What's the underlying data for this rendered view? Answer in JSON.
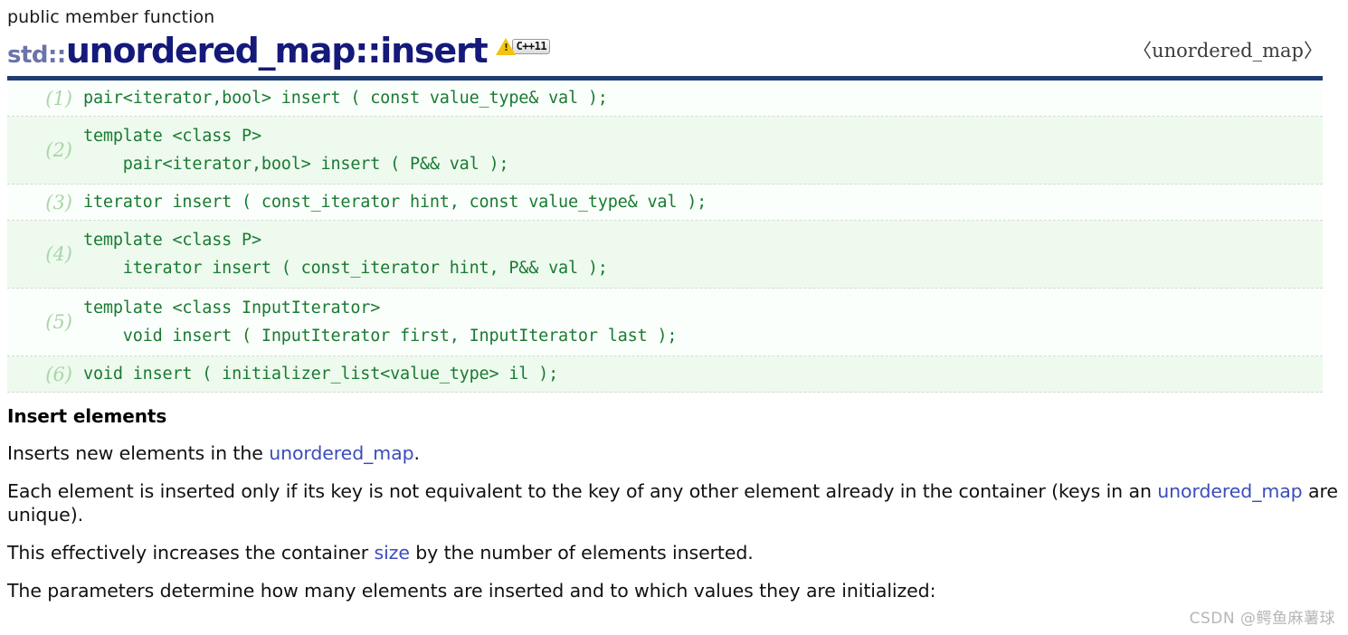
{
  "header": {
    "kind": "public member function",
    "namespace": "std::",
    "name": "unordered_map::insert",
    "badge": {
      "warning_icon": "warning-triangle-icon",
      "standard_label": "C++11"
    },
    "include": "〈unordered_map〉"
  },
  "signatures": [
    {
      "number": "(1)",
      "code": "pair<iterator,bool> insert ( const value_type& val );",
      "lines": 1
    },
    {
      "number": "(2)",
      "code": "template <class P>\n    pair<iterator,bool> insert ( P&& val );",
      "lines": 2
    },
    {
      "number": "(3)",
      "code": "iterator insert ( const_iterator hint, const value_type& val );",
      "lines": 1
    },
    {
      "number": "(4)",
      "code": "template <class P>\n    iterator insert ( const_iterator hint, P&& val );",
      "lines": 2
    },
    {
      "number": "(5)",
      "code": "template <class InputIterator>\n    void insert ( InputIterator first, InputIterator last );",
      "lines": 2
    },
    {
      "number": "(6)",
      "code": "void insert ( initializer_list<value_type> il );",
      "lines": 1
    }
  ],
  "body": {
    "section_title": "Insert elements",
    "p1_a": "Inserts new elements in the ",
    "p1_link": "unordered_map",
    "p1_b": ".",
    "p2_a": "Each element is inserted only if its key is not equivalent to the key of any other element already in the container (keys in an ",
    "p2_link": "unordered_map",
    "p2_b": " are unique).",
    "p3_a": "This effectively increases the container ",
    "p3_link": "size",
    "p3_b": " by the number of elements inserted.",
    "p4": "The parameters determine how many elements are inserted and to which values they are initialized:"
  },
  "watermark": "CSDN @鳄鱼麻薯球",
  "colors": {
    "title_navy": "#14197a",
    "namespace_slate": "#6b74a8",
    "rule_navy": "#1f3b73",
    "code_green": "#1a7a33",
    "number_green": "#a8d5a8",
    "row_alt_bg": "#eefaee",
    "row_bg": "#fbfffb",
    "link_blue": "#3a4dbb",
    "badge_yellow": "#f2c40f",
    "watermark_gray": "#b6b6b6"
  }
}
